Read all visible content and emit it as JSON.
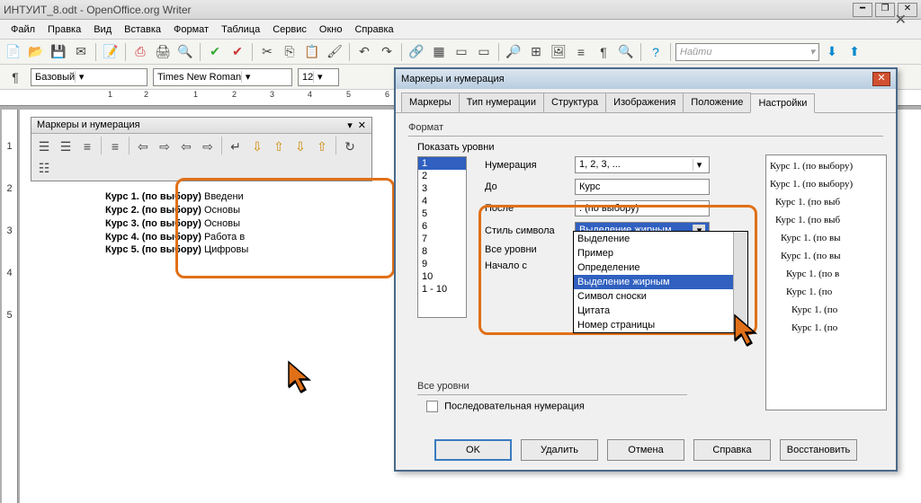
{
  "window": {
    "title": "ИНТУИТ_8.odt - OpenOffice.org Writer",
    "menu": [
      "Файл",
      "Правка",
      "Вид",
      "Вставка",
      "Формат",
      "Таблица",
      "Сервис",
      "Окно",
      "Справка"
    ]
  },
  "formatbar": {
    "style": "Базовый",
    "font": "Times New Roman",
    "size": "12"
  },
  "floating_toolbar": {
    "title": "Маркеры и нумерация"
  },
  "search": {
    "placeholder": "Найти"
  },
  "doc_lines": [
    {
      "bold": "Курс 1. (по выбору)",
      "rest": "  Введени"
    },
    {
      "bold": "Курс 2. (по выбору)",
      "rest": "  Основы "
    },
    {
      "bold": "Курс 3. (по выбору)",
      "rest": "  Основы "
    },
    {
      "bold": "Курс 4. (по выбору)",
      "rest": "  Работа в "
    },
    {
      "bold": "Курс 5. (по выбору)",
      "rest": "  Цифровы"
    }
  ],
  "dialog": {
    "title": "Маркеры и нумерация",
    "tabs": [
      "Маркеры",
      "Тип нумерации",
      "Структура",
      "Изображения",
      "Положение",
      "Настройки"
    ],
    "active_tab": 5,
    "format_label": "Формат",
    "show_levels_label": "Показать уровни",
    "levels": [
      "1",
      "2",
      "3",
      "4",
      "5",
      "6",
      "7",
      "8",
      "9",
      "10",
      "1 - 10"
    ],
    "selected_level": 0,
    "fields": {
      "numbering_label": "Нумерация",
      "numbering_value": "1, 2, 3, ...",
      "before_label": "До",
      "before_value": "Курс",
      "after_label": "После",
      "after_value": ". (по выбору)",
      "charstyle_label": "Стиль символа",
      "charstyle_value": "Выделение жирным",
      "alllevels_label": "Все уровни",
      "startat_label": "Начало с"
    },
    "dropdown_options": [
      "Выделение",
      "Пример",
      "Определение",
      "Выделение жирным",
      "Символ сноски",
      "Цитата",
      "Номер страницы"
    ],
    "dropdown_selected": 3,
    "all_levels_group": "Все уровни",
    "sequential_label": "Последовательная нумерация",
    "preview_lines": [
      "Курс 1. (по выбору)",
      "Курс 1. (по выбору)",
      "Курс 1. (по выб",
      "Курс 1. (по выб",
      "Курс 1. (по вы",
      "Курс 1. (по вы",
      "Курс 1. (по в",
      "Курс 1. (по ",
      "Курс 1. (по ",
      "Курс 1. (по"
    ],
    "buttons": {
      "ok": "OK",
      "delete": "Удалить",
      "cancel": "Отмена",
      "help": "Справка",
      "reset": "Восстановить"
    }
  },
  "ruler_ticks": [
    "1",
    "2",
    "1",
    "2",
    "3",
    "4",
    "5",
    "6"
  ],
  "vruler_ticks": [
    "1",
    "2",
    "3",
    "4",
    "5"
  ]
}
